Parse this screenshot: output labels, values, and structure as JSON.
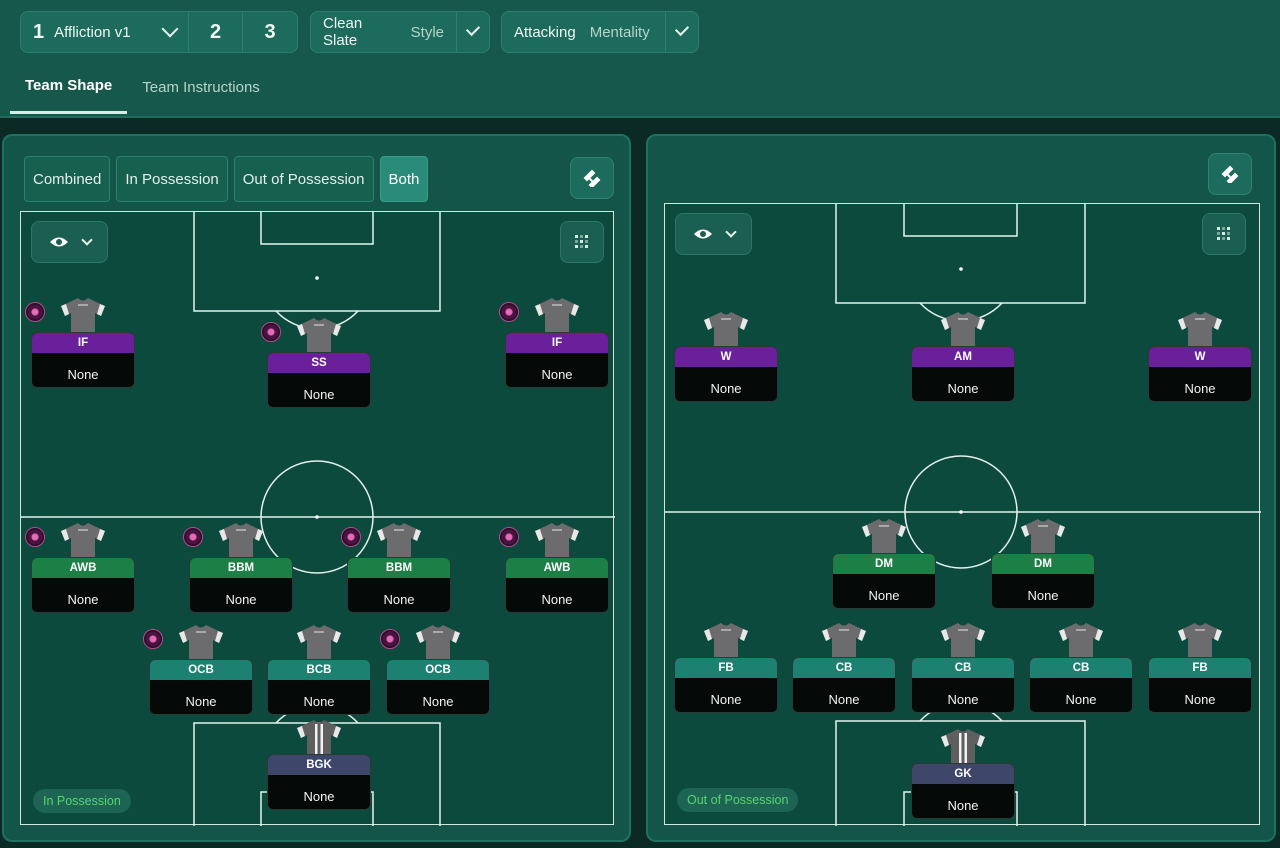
{
  "topbar": {
    "tactic": {
      "number": "1",
      "name": "Affliction v1"
    },
    "slots": [
      "2",
      "3"
    ],
    "style": {
      "value": "Clean Slate",
      "label": "Style"
    },
    "mentality": {
      "value": "Attacking",
      "label": "Mentality"
    },
    "tabs": [
      "Team Shape",
      "Team Instructions"
    ],
    "active_tab": "Team Shape"
  },
  "left_panel": {
    "filters": [
      "Combined",
      "In Possession",
      "Out of Possession",
      "Both"
    ],
    "active_filter": "Both",
    "phase_label": "In Possession",
    "players": [
      {
        "role": "IF",
        "duty": "None",
        "line": "att",
        "dot": true
      },
      {
        "role": "SS",
        "duty": "None",
        "line": "att",
        "dot": true
      },
      {
        "role": "IF",
        "duty": "None",
        "line": "att",
        "dot": true
      },
      {
        "role": "AWB",
        "duty": "None",
        "line": "mid",
        "dot": true
      },
      {
        "role": "BBM",
        "duty": "None",
        "line": "mid",
        "dot": true
      },
      {
        "role": "BBM",
        "duty": "None",
        "line": "mid",
        "dot": true
      },
      {
        "role": "AWB",
        "duty": "None",
        "line": "mid",
        "dot": true
      },
      {
        "role": "OCB",
        "duty": "None",
        "line": "def",
        "dot": true
      },
      {
        "role": "BCB",
        "duty": "None",
        "line": "def",
        "dot": false
      },
      {
        "role": "OCB",
        "duty": "None",
        "line": "def",
        "dot": true
      },
      {
        "role": "BGK",
        "duty": "None",
        "line": "gk",
        "dot": false
      }
    ]
  },
  "right_panel": {
    "phase_label": "Out of Possession",
    "players": [
      {
        "role": "W",
        "duty": "None",
        "line": "att",
        "dot": false
      },
      {
        "role": "AM",
        "duty": "None",
        "line": "att",
        "dot": false
      },
      {
        "role": "W",
        "duty": "None",
        "line": "att",
        "dot": false
      },
      {
        "role": "DM",
        "duty": "None",
        "line": "mid",
        "dot": false
      },
      {
        "role": "DM",
        "duty": "None",
        "line": "mid",
        "dot": false
      },
      {
        "role": "FB",
        "duty": "None",
        "line": "def",
        "dot": false
      },
      {
        "role": "CB",
        "duty": "None",
        "line": "def",
        "dot": false
      },
      {
        "role": "CB",
        "duty": "None",
        "line": "def",
        "dot": false
      },
      {
        "role": "CB",
        "duty": "None",
        "line": "def",
        "dot": false
      },
      {
        "role": "FB",
        "duty": "None",
        "line": "def",
        "dot": false
      },
      {
        "role": "GK",
        "duty": "None",
        "line": "gk",
        "dot": false
      }
    ]
  },
  "colors": {
    "attack_role": "#6a1f9b",
    "midfield_role": "#1c7f45",
    "defence_role": "#1d8172",
    "goalkeeper_role": "#3e4669",
    "phase_text": "#57d56c"
  },
  "icons": [
    "chevron-down-icon",
    "eye-icon",
    "formation-grid-icon",
    "swap-tactic-icon",
    "shirt-icon",
    "player-instruction-dot-icon"
  ]
}
